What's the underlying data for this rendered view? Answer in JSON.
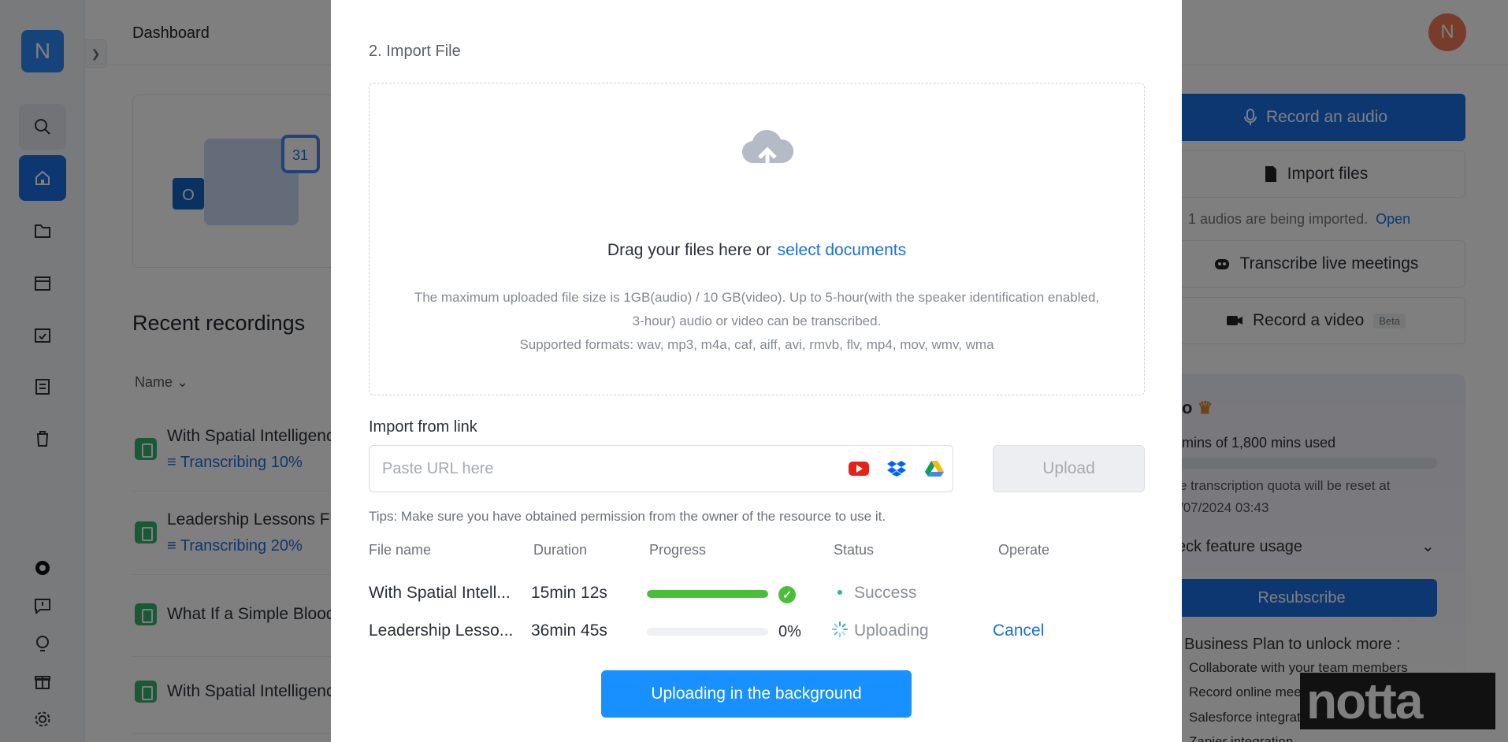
{
  "app": {
    "logo_letter": "N",
    "dashboard_title": "Dashboard",
    "avatar_letter": "N"
  },
  "recent": {
    "title": "Recent recordings",
    "name_column": "Name",
    "rows": [
      {
        "name": "With Spatial Intelligence",
        "status": "Transcribing 10%"
      },
      {
        "name": "Leadership Lessons From",
        "status": "Transcribing 20%"
      },
      {
        "name": "What If a Simple Blood",
        "status": ""
      },
      {
        "name": "With Spatial Intelligence",
        "status": ""
      }
    ]
  },
  "right_panel": {
    "record_audio": "Record an audio",
    "import_files": "Import files",
    "importing_note": "1 audios are being imported.",
    "open_link": "Open",
    "transcribe_live": "Transcribe live meetings",
    "record_video": "Record a video",
    "beta": "Beta",
    "plan_name": "o",
    "mins_used": "mins of 1,800 mins used",
    "quota_line1": "e transcription quota will be reset at",
    "quota_line2": "/07/2024 03:43",
    "feature_usage": "eck feature usage",
    "resubscribe": "Resubscribe",
    "business_plan": "t Business Plan to unlock more :",
    "features": [
      "Collaborate with your team members",
      "Record online mee",
      "Salesforce integration",
      "Zapier integration"
    ],
    "watermark": "notta"
  },
  "modal": {
    "section_title": "2. Import File",
    "drag_text": "Drag your files here or",
    "select_link": "select documents",
    "limit_line1": "The maximum uploaded file size is 1GB(audio) / 10 GB(video). Up to 5-hour(with the speaker identification enabled,",
    "limit_line2": "3-hour) audio or video can be transcribed.",
    "formats_line": "Supported formats: wav, mp3, m4a, caf, aiff, avi, rmvb, flv, mp4, mov, wmv, wma",
    "link_label": "Import from link",
    "url_placeholder": "Paste URL here",
    "upload_button": "Upload",
    "tips": "Tips: Make sure you have obtained permission from the owner of the resource to use it.",
    "columns": {
      "file_name": "File name",
      "duration": "Duration",
      "progress": "Progress",
      "status": "Status",
      "operate": "Operate"
    },
    "files": [
      {
        "name": "With Spatial Intell...",
        "duration": "15min 12s",
        "progress": 1.0,
        "percent": "",
        "status": "Success",
        "operate": ""
      },
      {
        "name": "Leadership Lesso...",
        "duration": "36min 45s",
        "progress": 0.0,
        "percent": "0%",
        "status": "Uploading",
        "operate": "Cancel"
      }
    ],
    "background_button": "Uploading in the background"
  },
  "icons": [
    "search-icon",
    "home-icon",
    "folder-icon",
    "calendar-icon",
    "calendar-check-icon",
    "document-icon",
    "trash-icon",
    "record-icon",
    "feedback-icon",
    "lightbulb-icon",
    "gift-icon",
    "gear-icon",
    "cloud-upload-icon",
    "youtube-icon",
    "dropbox-icon",
    "google-drive-icon",
    "microphone-icon",
    "file-icon",
    "bot-icon",
    "video-icon",
    "crown-icon",
    "chevron-down-icon",
    "check-circle-icon",
    "spinner-icon"
  ],
  "colors": {
    "primary": "#1b6fe0",
    "bg_button": "#1890ff",
    "success": "#4cbd3b",
    "logo": "#2f86f6",
    "avatar": "#f07a55"
  }
}
